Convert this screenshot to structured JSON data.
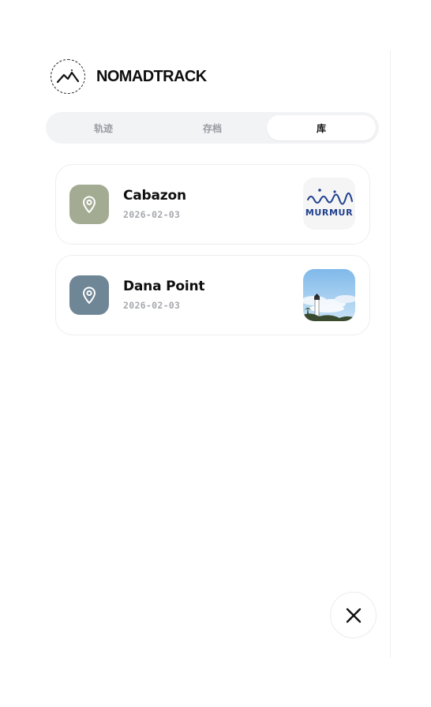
{
  "app": {
    "brand": "NOMADTRACK",
    "logo_icon": "mountain-logo-icon"
  },
  "tabs": [
    {
      "label": "轨迹",
      "active": false
    },
    {
      "label": "存档",
      "active": false
    },
    {
      "label": "库",
      "active": true
    }
  ],
  "library": {
    "items": [
      {
        "title": "Cabazon",
        "date": "2026-02-03",
        "icon": "map-pin-icon",
        "icon_bg": "#a3ab93",
        "thumbnail": {
          "kind": "logo",
          "text": "MURMUR",
          "color": "#1f3f8f"
        }
      },
      {
        "title": "Dana Point",
        "date": "2026-02-03",
        "icon": "map-pin-icon",
        "icon_bg": "#6f8696",
        "thumbnail": {
          "kind": "photo",
          "description_icon": "lighthouse-photo"
        }
      }
    ]
  },
  "close_icon": "close-icon"
}
